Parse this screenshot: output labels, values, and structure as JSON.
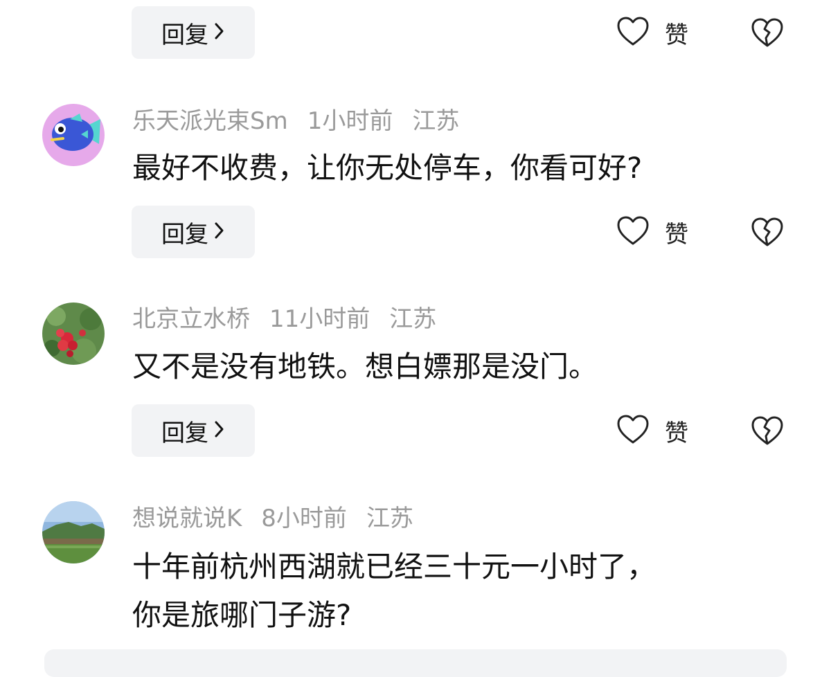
{
  "reply_label": "回复",
  "like_label": "赞",
  "comments": [
    {
      "username": "乐天派光束Sm",
      "time": "1小时前",
      "location": "江苏",
      "text": [
        "最好不收费，让你无处停车，你看可好?"
      ],
      "avatar_icon": "blue-fish-avatar"
    },
    {
      "username": "北京立水桥",
      "time": "11小时前",
      "location": "江苏",
      "text": [
        "又不是没有地铁。想白嫖那是没门。"
      ],
      "avatar_icon": "red-flowers-avatar"
    },
    {
      "username": "想说就说K",
      "time": "8小时前",
      "location": "江苏",
      "text": [
        "十年前杭州西湖就已经三十元一小时了，",
        "你是旅哪门子游?"
      ],
      "avatar_icon": "landscape-avatar"
    }
  ],
  "colors": {
    "meta_gray": "#9a9a9a",
    "reply_bg": "#f2f3f5",
    "text": "#111111"
  }
}
